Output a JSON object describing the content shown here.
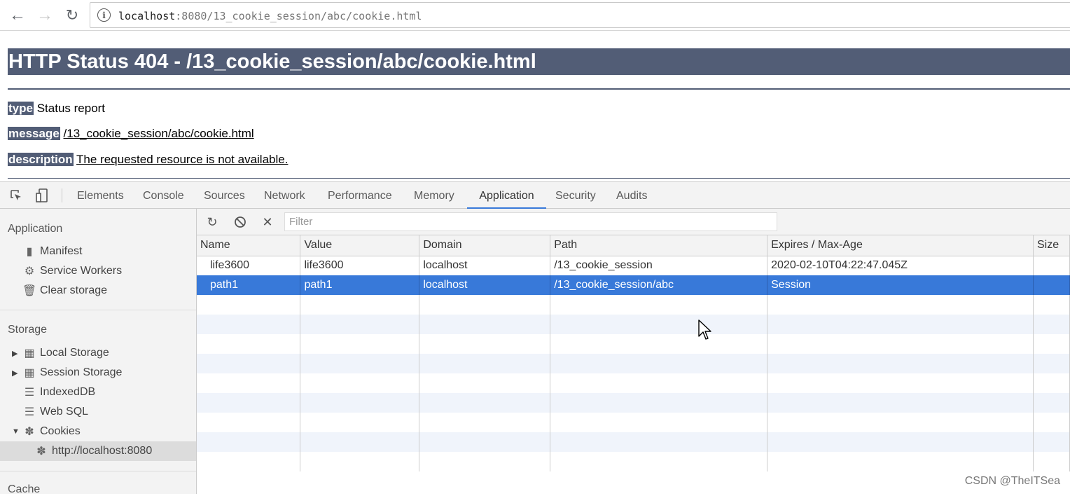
{
  "browser": {
    "url_host": "localhost",
    "url_rest": ":8080/13_cookie_session/abc/cookie.html"
  },
  "page": {
    "title": "HTTP Status 404 - /13_cookie_session/abc/cookie.html",
    "rows": [
      {
        "label": "type",
        "value": "Status report"
      },
      {
        "label": "message",
        "value": "/13_cookie_session/abc/cookie.html"
      },
      {
        "label": "description",
        "value": "The requested resource is not available."
      }
    ]
  },
  "devtools": {
    "tabs": [
      "Elements",
      "Console",
      "Sources",
      "Network",
      "Performance",
      "Memory",
      "Application",
      "Security",
      "Audits"
    ],
    "active_tab": "Application",
    "sidebar": {
      "application_header": "Application",
      "application_items": [
        "Manifest",
        "Service Workers",
        "Clear storage"
      ],
      "storage_header": "Storage",
      "storage_items": [
        "Local Storage",
        "Session Storage",
        "IndexedDB",
        "Web SQL",
        "Cookies"
      ],
      "cookie_origin": "http://localhost:8080",
      "cache_header": "Cache"
    },
    "filter_placeholder": "Filter",
    "columns": [
      "Name",
      "Value",
      "Domain",
      "Path",
      "Expires / Max-Age",
      "Size"
    ],
    "cookies": [
      [
        "life3600",
        "life3600",
        "localhost",
        "/13_cookie_session",
        "2020-02-10T04:22:47.045Z",
        ""
      ],
      [
        "path1",
        "path1",
        "localhost",
        "/13_cookie_session/abc",
        "Session",
        ""
      ]
    ],
    "selected_row": 1
  },
  "watermark": "CSDN @TheITSea",
  "colors": {
    "tomcat_header": "#525d76",
    "selection": "#3879d9"
  }
}
